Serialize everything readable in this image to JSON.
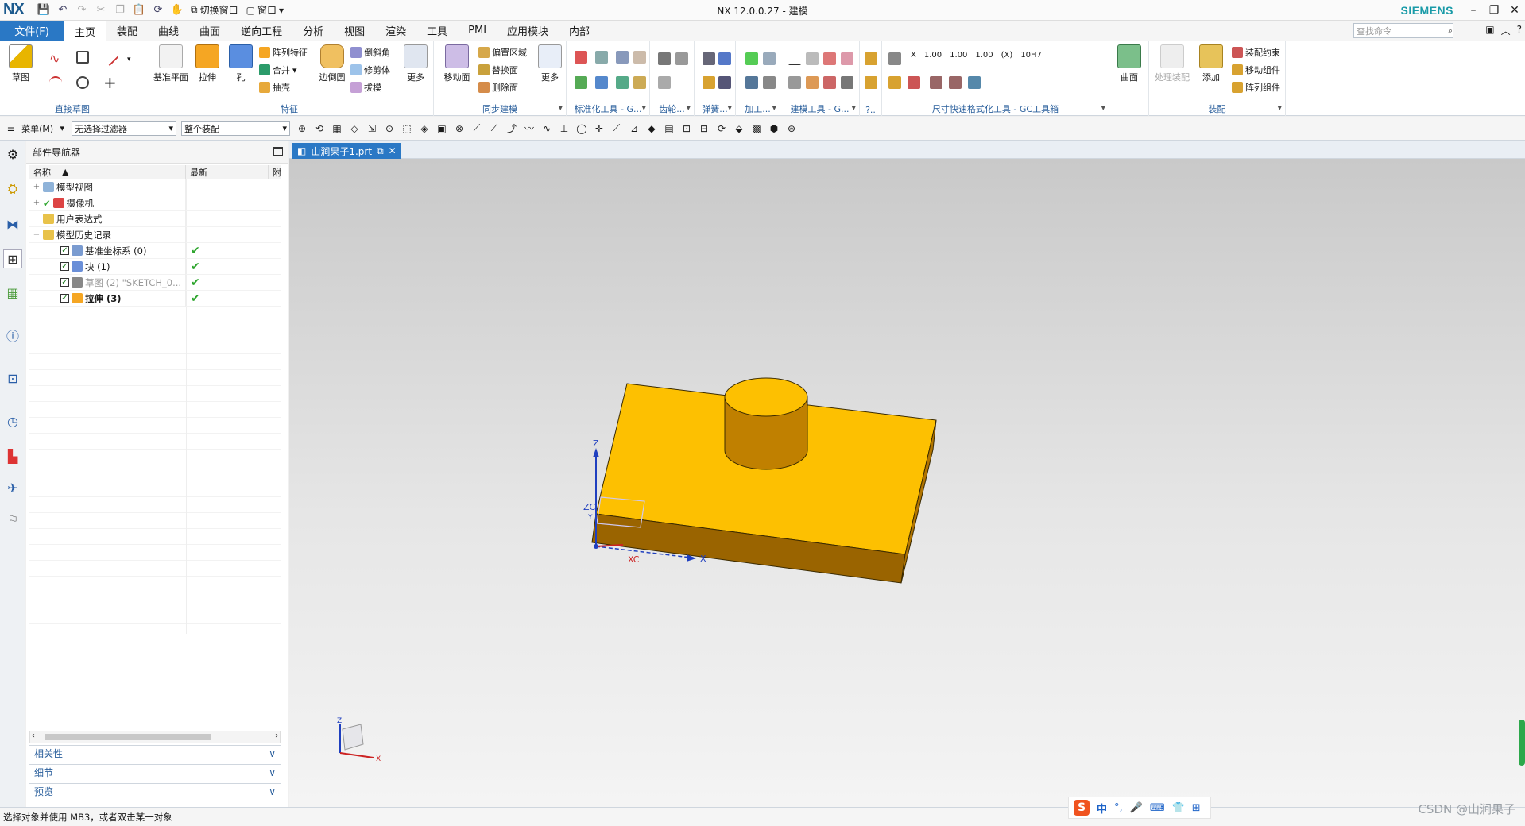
{
  "titlebar": {
    "logo": "NX",
    "switch_window": "切换窗口",
    "window": "窗口",
    "title": "NX 12.0.0.27 - 建模",
    "brand": "SIEMENS"
  },
  "menu": {
    "file": "文件(F)",
    "tabs": [
      "主页",
      "装配",
      "曲线",
      "曲面",
      "逆向工程",
      "分析",
      "视图",
      "渲染",
      "工具",
      "PMI",
      "应用模块",
      "内部"
    ],
    "active_tab": "主页",
    "search_placeholder": "查找命令"
  },
  "ribbon": {
    "groups": {
      "direct_sketch": "直接草图",
      "feature": "特征",
      "sync": "同步建模",
      "std_tools": "标准化工具 - G...",
      "gear": "齿轮...",
      "spring": "弹簧...",
      "machining": "加工...",
      "modeling_tools": "建模工具 - G...",
      "q": "?..",
      "dim_tools": "尺寸快速格式化工具 - GC工具箱",
      "assembly": "装配"
    },
    "buttons": {
      "sketch": "草图",
      "datum_plane": "基准平面",
      "extrude": "拉伸",
      "hole": "孔",
      "pattern_feature": "阵列特征",
      "unite": "合并",
      "shell": "抽壳",
      "edge_blend": "边倒圆",
      "chamfer": "倒斜角",
      "trim_body": "修剪体",
      "draft": "拔模",
      "more1": "更多",
      "move_face": "移动面",
      "offset_region": "偏置区域",
      "replace_face": "替换面",
      "delete_face": "删除面",
      "more2": "更多",
      "surface": "曲面",
      "process_assembly": "处理装配",
      "add": "添加",
      "assembly_constraint": "装配约束",
      "move_component": "移动组件",
      "pattern_component": "阵列组件",
      "dim_labels": [
        "X",
        "1.00",
        "1.00",
        "1.00",
        "(X)",
        "10H7"
      ]
    }
  },
  "selection": {
    "menu": "菜单(M)",
    "filter": "无选择过滤器",
    "scope": "整个装配"
  },
  "navigator": {
    "title": "部件导航器",
    "col_name": "名称",
    "col_latest": "最新",
    "col_extra": "附",
    "items": [
      {
        "label": "模型视图",
        "latest": ""
      },
      {
        "label": "摄像机",
        "latest": ""
      },
      {
        "label": "用户表达式",
        "latest": ""
      },
      {
        "label": "模型历史记录",
        "latest": ""
      },
      {
        "label": "基准坐标系 (0)",
        "latest": "✔"
      },
      {
        "label": "块 (1)",
        "latest": "✔"
      },
      {
        "label": "草图 (2) \"SKETCH_0...",
        "latest": "✔"
      },
      {
        "label": "拉伸 (3)",
        "latest": "✔"
      }
    ],
    "sections": [
      "相关性",
      "细节",
      "预览"
    ]
  },
  "viewport": {
    "tab": "山涧果子1.prt",
    "axis_z": "Z",
    "axis_zc": "ZC",
    "axis_y": "Y",
    "axis_x": "X",
    "axis_xc": "XC",
    "triad_z": "Z",
    "triad_x": "X",
    "colors": {
      "top": "#fdc001",
      "front": "#9a6400",
      "side": "#b17400",
      "cyl_side": "#c08000"
    }
  },
  "status": {
    "message": "选择对象并使用 MB3，或者双击某一对象"
  },
  "ime": {
    "logo": "S",
    "lang": "中"
  },
  "watermark": "CSDN @山涧果子"
}
